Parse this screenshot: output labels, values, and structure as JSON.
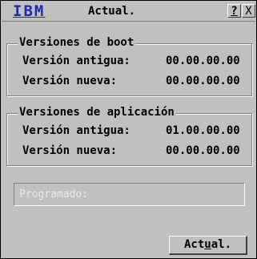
{
  "window": {
    "logo": "IBM",
    "title": "Actual.",
    "help_label": "?",
    "close_label": "X"
  },
  "boot": {
    "legend": "Versiones de boot",
    "old_label": "Versión antigua:",
    "old_value": "00.00.00.00",
    "new_label": "Versión nueva:",
    "new_value": "00.00.00.00"
  },
  "app": {
    "legend": "Versiones de aplicación",
    "old_label": "Versión antigua:",
    "old_value": "01.00.00.00",
    "new_label": "Versión nueva:",
    "new_value": "00.00.00.00"
  },
  "progress": {
    "text": "Programado:"
  },
  "update_button": {
    "label_pre": "Act",
    "label_underlined": "u",
    "label_post": "al."
  }
}
